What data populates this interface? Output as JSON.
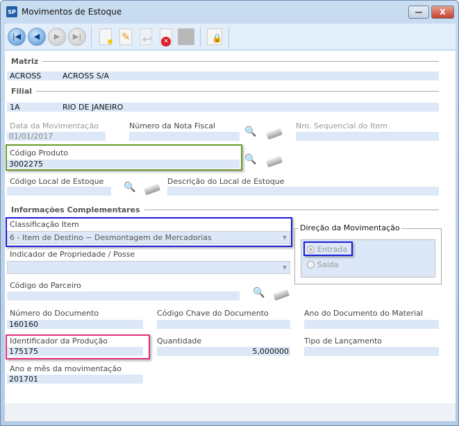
{
  "window": {
    "title": "Movimentos de Estoque",
    "app_icon": "SP",
    "minimize": "—",
    "close": "X"
  },
  "toolbar": {
    "icons": [
      "first-record-icon",
      "previous-record-icon",
      "next-record-icon",
      "last-record-icon",
      "new-icon",
      "edit-icon",
      "undo-icon",
      "delete-icon",
      "save-icon",
      "lock-icon"
    ]
  },
  "matriz": {
    "label": "Matriz",
    "code": "ACROSS",
    "name": "ACROSS S/A"
  },
  "filial": {
    "label": "Filial",
    "code": "1A",
    "name": "RIO DE JANEIRO"
  },
  "fields": {
    "data_mov": {
      "label": "Data da Movimentação",
      "value": "01/01/2017"
    },
    "nota_fiscal": {
      "label": "Número da Nota Fiscal",
      "value": ""
    },
    "nro_seq": {
      "label": "Nro. Sequencial do Item",
      "value": ""
    },
    "codigo_produto": {
      "label": "Código Produto",
      "value": "3002275"
    },
    "codigo_local": {
      "label": "Código Local de Estoque",
      "value": ""
    },
    "descricao_local": {
      "label": "Descrição do Local de Estoque",
      "value": ""
    },
    "info_comp": "Informações Complementares",
    "classificacao": {
      "label": "Classificação Item",
      "value": "6 - Item de Destino − Desmontagem de Mercadorias"
    },
    "indicador": {
      "label": "Indicador de Propriedade / Posse",
      "value": ""
    },
    "direcao": {
      "label": "Direção da Movimentação",
      "options": [
        "Entrada",
        "Saída"
      ],
      "selected": "Entrada"
    },
    "parceiro": {
      "label": "Código do Parceiro",
      "value": ""
    },
    "num_doc": {
      "label": "Número do Documento",
      "value": "160160"
    },
    "chave_doc": {
      "label": "Código Chave do Documento",
      "value": ""
    },
    "ano_doc": {
      "label": "Ano do Documento do Material",
      "value": ""
    },
    "ident_prod": {
      "label": "Identificador da Produção",
      "value": "175175"
    },
    "quantidade": {
      "label": "Quantidade",
      "value": "5,000000"
    },
    "tipo_lanc": {
      "label": "Tipo de Lançamento",
      "value": ""
    },
    "ano_mes": {
      "label": "Ano e mês da movimentação",
      "value": "201701"
    }
  },
  "highlight_colors": {
    "green": "#6a9a2a",
    "blue": "#1a1adb",
    "pink": "#e0307a"
  }
}
